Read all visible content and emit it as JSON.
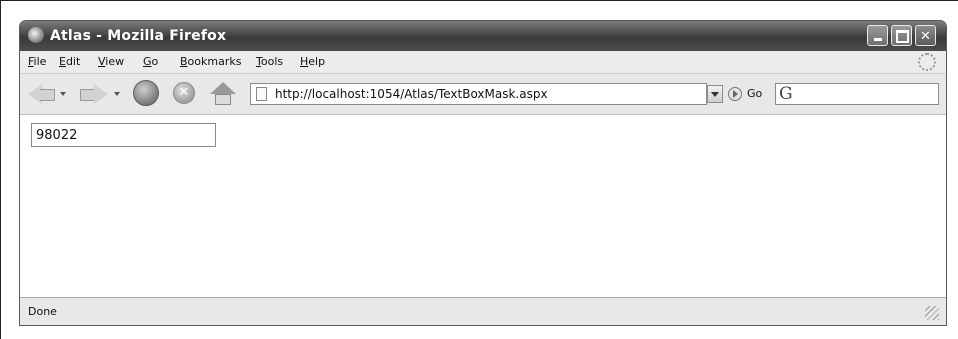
{
  "window": {
    "title": "Atlas - Mozilla Firefox"
  },
  "menubar": {
    "items": [
      "File",
      "Edit",
      "View",
      "Go",
      "Bookmarks",
      "Tools",
      "Help"
    ]
  },
  "navigation": {
    "url": "http://localhost:1054/Atlas/TextBoxMask.aspx",
    "go_label": "Go",
    "search_engine_glyph": "G"
  },
  "page": {
    "textbox_value": "98022"
  },
  "status": {
    "text": "Done"
  },
  "icons": [
    "firefox-icon",
    "minimize-icon",
    "maximize-icon",
    "close-icon",
    "throbber-icon",
    "back-icon",
    "forward-icon",
    "reload-icon",
    "stop-icon",
    "home-icon",
    "page-icon",
    "url-dropdown-icon",
    "go-icon",
    "search-engine-icon",
    "resize-grip-icon"
  ]
}
